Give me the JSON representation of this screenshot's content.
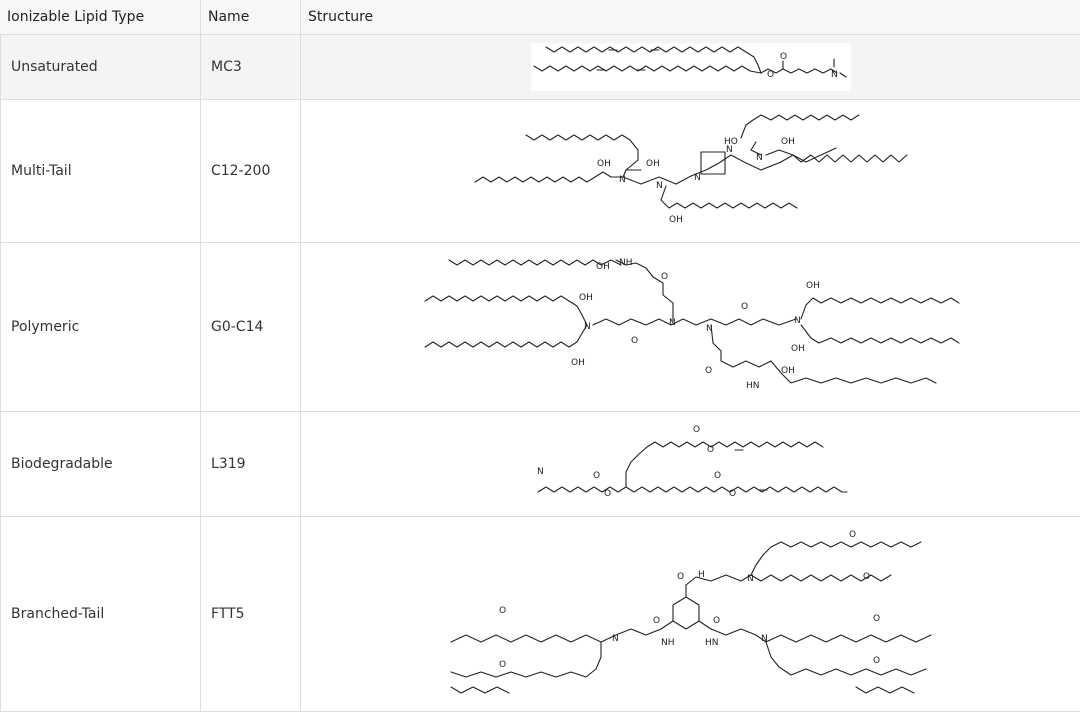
{
  "table": {
    "headers": {
      "type": "Ionizable Lipid Type",
      "name": "Name",
      "structure": "Structure"
    },
    "rows": [
      {
        "type": "Unsaturated",
        "name": "MC3",
        "structure_icon": "mc3-structure"
      },
      {
        "type": "Multi-Tail",
        "name": "C12-200",
        "structure_icon": "c12-200-structure"
      },
      {
        "type": "Polymeric",
        "name": "G0-C14",
        "structure_icon": "g0-c14-structure"
      },
      {
        "type": "Biodegradable",
        "name": "L319",
        "structure_icon": "l319-structure"
      },
      {
        "type": "Branched-Tail",
        "name": "FTT5",
        "structure_icon": "ftt5-structure"
      }
    ]
  },
  "labels": {
    "n": "N",
    "o": "O",
    "oh": "OH",
    "ho": "HO",
    "nh": "NH",
    "hn": "HN",
    "h": "H"
  }
}
